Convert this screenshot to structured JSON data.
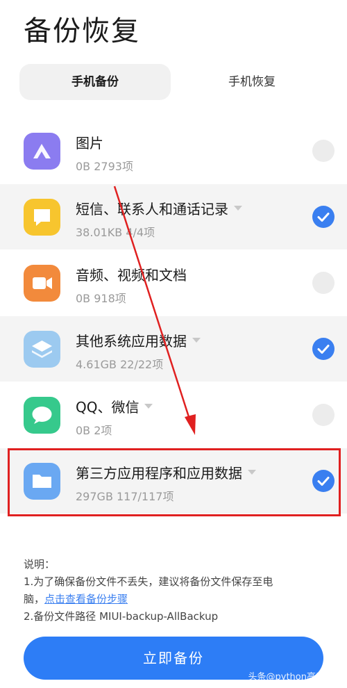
{
  "title": "备份恢复",
  "tabs": [
    {
      "label": "手机备份",
      "active": true
    },
    {
      "label": "手机恢复",
      "active": false
    }
  ],
  "items": [
    {
      "name": "图片",
      "detail": "0B  2793项",
      "checked": false,
      "has_caret": false,
      "icon": "photos-icon",
      "icon_color": "#8b7cf0"
    },
    {
      "name": "短信、联系人和通话记录",
      "detail": "38.01KB  4/4项",
      "checked": true,
      "has_caret": true,
      "icon": "message-icon",
      "icon_color": "#f7c52e"
    },
    {
      "name": "音频、视频和文档",
      "detail": "0B  918项",
      "checked": false,
      "has_caret": false,
      "icon": "video-icon",
      "icon_color": "#f28a3c"
    },
    {
      "name": "其他系统应用数据",
      "detail": "4.61GB  22/22项",
      "checked": true,
      "has_caret": true,
      "icon": "layers-icon",
      "icon_color": "#9ccaf0"
    },
    {
      "name": "QQ、微信",
      "detail": "0B  2项",
      "checked": false,
      "has_caret": true,
      "icon": "chat-bubble-icon",
      "icon_color": "#36c98c"
    },
    {
      "name": "第三方应用程序和应用数据",
      "detail": "297GB  117/117项",
      "checked": true,
      "has_caret": true,
      "icon": "folder-icon",
      "icon_color": "#6aa8f2"
    }
  ],
  "note": {
    "heading": "说明：",
    "line1": "1.为了确保备份文件不丢失，建议将备份文件保存至电",
    "line2_prefix": "脑，",
    "link": "点击查看备份步骤",
    "line3": "2.备份文件路径 MIUI-backup-AllBackup"
  },
  "button": {
    "label": "立即备份"
  },
  "watermark": "头条@python高手养成",
  "colors": {
    "accent": "#2d7df6",
    "highlight_box": "#e02020",
    "arrow": "#e02020"
  }
}
